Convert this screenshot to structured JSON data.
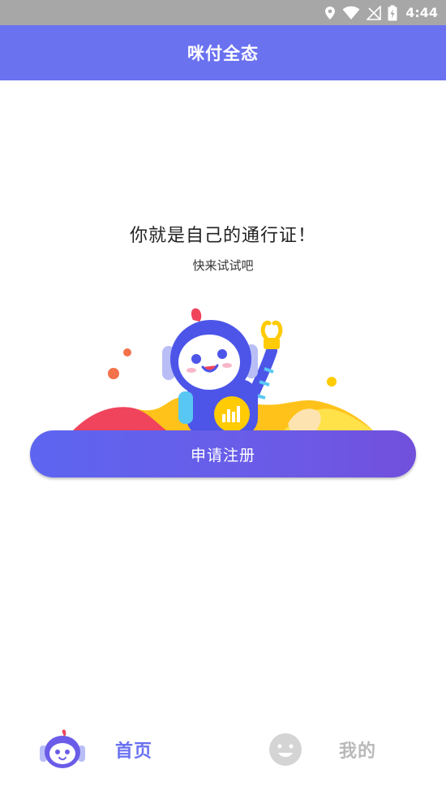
{
  "status_bar": {
    "time": "4:44",
    "icons": [
      "location-icon",
      "wifi-icon",
      "no-signal-icon",
      "battery-charging-icon"
    ]
  },
  "header": {
    "title": "咪付全态"
  },
  "main": {
    "headline": "你就是自己的通行证！",
    "subline": "快来试试吧",
    "illustration": "robot-waving-illustration",
    "register_button": "申请注册"
  },
  "tab_bar": {
    "tabs": [
      {
        "label": "首页",
        "icon": "robot-head-icon",
        "active": true
      },
      {
        "label": "我的",
        "icon": "smiley-face-icon",
        "active": false
      }
    ]
  },
  "colors": {
    "primary": "#6a72f0",
    "status_bar": "#a7a7a7",
    "inactive_tab": "#b9b9b9"
  }
}
